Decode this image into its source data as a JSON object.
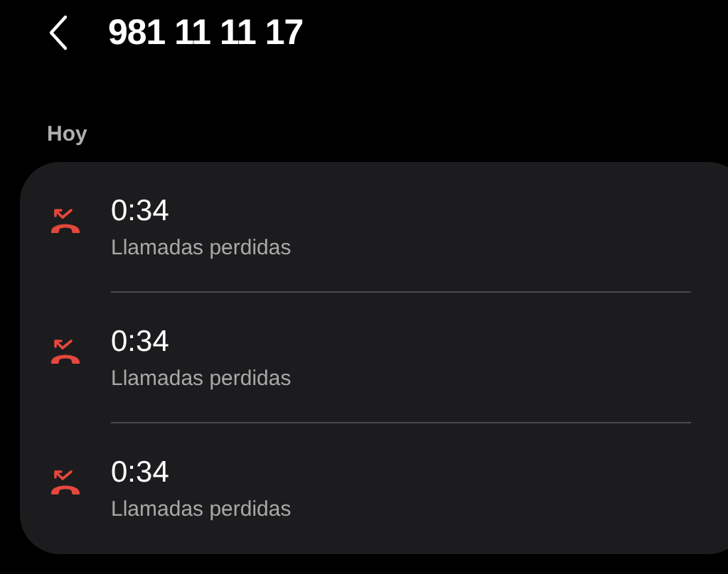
{
  "header": {
    "title": "981 11 11 17"
  },
  "section": {
    "label": "Hoy"
  },
  "calls": [
    {
      "kind": "missed",
      "time": "0:34",
      "type": "Llamadas perdidas"
    },
    {
      "kind": "missed",
      "time": "0:34",
      "type": "Llamadas perdidas"
    },
    {
      "kind": "missed",
      "time": "0:34",
      "type": "Llamadas perdidas"
    }
  ]
}
